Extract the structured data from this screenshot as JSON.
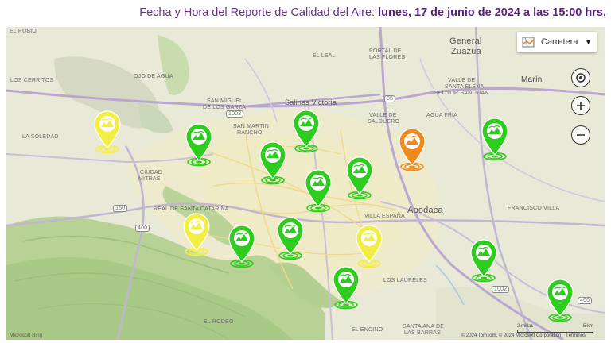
{
  "header": {
    "prefix": "Fecha y Hora del Reporte de Calidad del Aire: ",
    "datetime": "lunes, 17 de junio de 2024 a las 15:00 hrs."
  },
  "map_style": {
    "label": "Carretera",
    "icon": "map-style-icon",
    "caret": "chevron-down-icon"
  },
  "controls": {
    "locate_icon": "locate-icon",
    "zoom_in_icon": "plus-icon",
    "zoom_out_icon": "minus-icon"
  },
  "places": {
    "el_rubio": "EL RUBIO",
    "general_zuazua_1": "General",
    "general_zuazua_2": "Zuazua",
    "marin": "Marín",
    "los_cerritos": "LOS CERRITOS",
    "ojo_de_agua": "OJO DE AGUA",
    "el_leal": "EL LEAL",
    "portal_flores_1": "PORTAL DE",
    "portal_flores_2": "LAS FLORES",
    "salinas_victoria": "Salinas Victoria",
    "san_miguel_1": "SAN MIGUEL",
    "san_miguel_2": "DE LOS GARZA",
    "valle_santa_elena_1": "VALLE DE",
    "valle_santa_elena_2": "SANTA ELENA",
    "valle_santa_elena_3": "SECTOR SAN JUAN",
    "la_soledad": "LA SOLEDAD",
    "san_martin_1": "SAN MARTIN",
    "san_martin_2": "RANCHO",
    "valle_salduero_1": "VALLE DE",
    "valle_salduero_2": "SALDUERO",
    "agua_fria": "AGUA FRÍA",
    "ciudad_mitras_1": "CIUDAD",
    "ciudad_mitras_2": "MITRAS",
    "apodaca": "Apodaca",
    "real_santa_catarina": "REAL DE SANTA CATARINA",
    "villa_espana": "VILLA ESPAÑA",
    "francisco_villa": "FRANCISCO VILLA",
    "los_laureles": "LOS LAURELES",
    "el_rodeo": "EL RODEO",
    "el_encino": "EL ENCINO",
    "santa_ana_1": "SANTA ANA DE",
    "santa_ana_2": "LAS BARRAS"
  },
  "roads": [
    "1002",
    "85",
    "160",
    "400",
    "1002",
    "400"
  ],
  "stations": [
    {
      "status": "yellow"
    },
    {
      "status": "green"
    },
    {
      "status": "green"
    },
    {
      "status": "green"
    },
    {
      "status": "green"
    },
    {
      "status": "green"
    },
    {
      "status": "orange"
    },
    {
      "status": "green"
    },
    {
      "status": "yellow"
    },
    {
      "status": "green"
    },
    {
      "status": "green"
    },
    {
      "status": "yellow"
    },
    {
      "status": "green"
    },
    {
      "status": "green"
    },
    {
      "status": "green"
    }
  ],
  "colors": {
    "green": "#2ecc1f",
    "yellow": "#f3ee44",
    "orange": "#f08a1c",
    "header_text": "#6a2c8c"
  },
  "scale": {
    "miles": "2 millas",
    "km": "5 km"
  },
  "copyright": "© 2024 TomTom, © 2024 Microsoft Corporation",
  "terms": "Términos",
  "logo": "Microsoft Bing"
}
